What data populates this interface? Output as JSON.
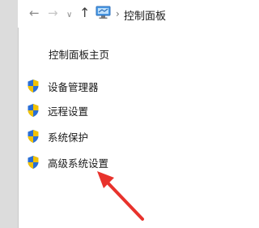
{
  "navigation": {
    "back_icon": "arrow-left-icon",
    "forward_icon": "arrow-right-icon",
    "recent_icon": "chevron-down-icon",
    "up_icon": "arrow-up-icon",
    "breadcrumb": {
      "icon": "control-panel-icon",
      "separator": "›",
      "label": "控制面板"
    }
  },
  "sidebar": {
    "home_link": "控制面板主页",
    "items": [
      {
        "label": "设备管理器",
        "icon": "shield-icon"
      },
      {
        "label": "远程设置",
        "icon": "shield-icon"
      },
      {
        "label": "系统保护",
        "icon": "shield-icon"
      },
      {
        "label": "高级系统设置",
        "icon": "shield-icon"
      }
    ]
  },
  "annotation": {
    "arrow_color": "#e8322c",
    "points_to": "高级系统设置"
  },
  "colors": {
    "shield_blue": "#2a6fd6",
    "shield_yellow": "#f2c200",
    "border_gray": "#dcdcdc"
  }
}
